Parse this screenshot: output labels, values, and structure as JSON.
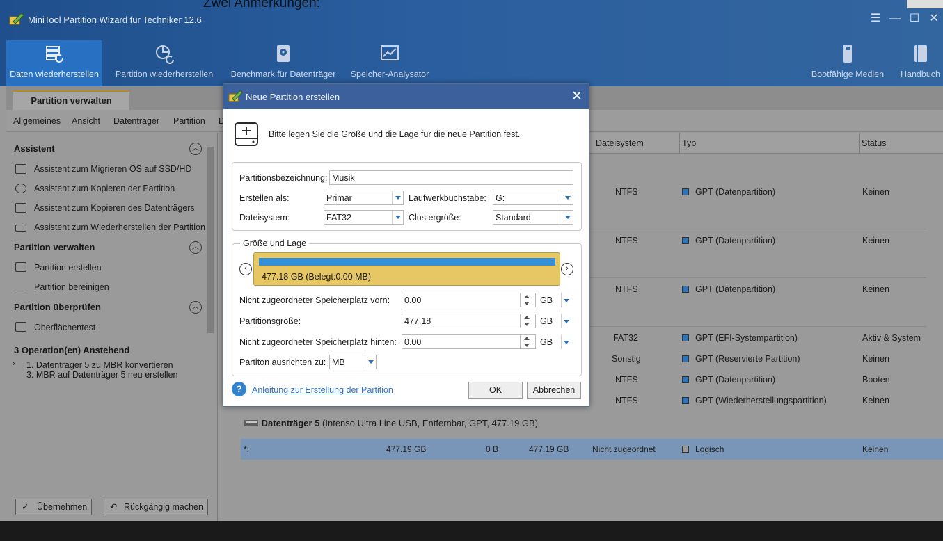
{
  "background_text": "Zwei Anmerkungen:",
  "app": {
    "title": "MiniTool Partition Wizard für Techniker 12.6"
  },
  "window_icons": {
    "menu": "hamburger-icon",
    "minimize": "minimize-icon",
    "maximize": "maximize-icon",
    "close": "close-icon"
  },
  "toolbar": {
    "items": [
      {
        "label": "Daten wiederherstellen",
        "icon": "data-recovery-icon",
        "active": true
      },
      {
        "label": "Partition wiederherstellen",
        "icon": "partition-recovery-icon"
      },
      {
        "label": "Benchmark für Datenträger",
        "icon": "disk-benchmark-icon"
      },
      {
        "label": "Speicher-Analysator",
        "icon": "space-analyzer-icon"
      },
      {
        "label": "Bootfähige Medien",
        "icon": "bootable-media-icon"
      },
      {
        "label": "Handbuch",
        "icon": "manual-icon"
      }
    ]
  },
  "tab": {
    "label": "Partition verwalten"
  },
  "menu": {
    "items": [
      "Allgemeines",
      "Ansicht",
      "Datenträger",
      "Partition",
      "D"
    ]
  },
  "left": {
    "sections": [
      {
        "title": "Assistent",
        "items": [
          "Assistent zum Migrieren OS auf SSD/HD",
          "Assistent zum Kopieren der Partition",
          "Assistent zum Kopieren des Datenträgers",
          "Assistent zum Wiederherstellen der Partition"
        ]
      },
      {
        "title": "Partition verwalten",
        "items": [
          "Partition erstellen",
          "Partition bereinigen"
        ]
      },
      {
        "title": "Partition überprüfen",
        "items": [
          "Oberflächentest"
        ]
      }
    ],
    "pending": {
      "title": "3 Operation(en) Anstehend",
      "items": [
        "1. Datenträger 5 zu MBR konvertieren",
        "3. MBR auf Datenträger 5 neu erstellen"
      ]
    },
    "apply_label": "Übernehmen",
    "undo_label": "Rückgängig machen"
  },
  "table": {
    "headers": {
      "filesystem": "Dateisystem",
      "type": "Typ",
      "status": "Status"
    },
    "rows": [
      {
        "fs": "NTFS",
        "type": "GPT (Datenpartition)",
        "status": "Keinen"
      },
      {
        "fs": "NTFS",
        "type": "GPT (Datenpartition)",
        "status": "Keinen"
      },
      {
        "fs": "NTFS",
        "type": "GPT (Datenpartition)",
        "status": "Keinen"
      },
      {
        "fs": "FAT32",
        "type": "GPT (EFI-Systempartition)",
        "status": "Aktiv & System"
      },
      {
        "fs": "Sonstig",
        "type": "GPT (Reservierte Partition)",
        "status": "Keinen"
      },
      {
        "fs": "NTFS",
        "type": "GPT (Datenpartition)",
        "status": "Booten"
      },
      {
        "fs": "NTFS",
        "type": "GPT (Wiederherstellungspartition)",
        "status": "Keinen"
      }
    ],
    "disk5": {
      "name": "Datenträger 5",
      "detail": " (Intenso Ultra Line USB, Entfernbar, GPT, 477.19 GB)"
    },
    "disk5_row": {
      "name": "*:",
      "capacity": "477.19 GB",
      "used": "0 B",
      "unused": "477.19 GB",
      "fs": "Nicht zugeordnet",
      "type": "Logisch",
      "status": "Keinen"
    }
  },
  "dialog": {
    "title": "Neue Partition erstellen",
    "intro": "Bitte legen Sie die Größe und die Lage für die neue Partition fest.",
    "fields": {
      "label_lbl": "Partitionsbezeichnung:",
      "label_val": "Musik",
      "create_as_lbl": "Erstellen als:",
      "create_as_val": "Primär",
      "drive_letter_lbl": "Laufwerkbuchstabe:",
      "drive_letter_val": "G:",
      "filesystem_lbl": "Dateisystem:",
      "filesystem_val": "FAT32",
      "cluster_lbl": "Clustergröße:",
      "cluster_val": "Standard"
    },
    "size_group": {
      "title": "Größe und Lage",
      "bar_label": "477.18 GB (Belegt:0.00 MB)",
      "unalloc_before_lbl": "Nicht zugeordneter Speicherplatz vorn:",
      "unalloc_before_val": "0.00",
      "size_lbl": "Partitionsgröße:",
      "size_val": "477.18",
      "unalloc_after_lbl": "Nicht zugeordneter Speicherplatz hinten:",
      "unalloc_after_val": "0.00",
      "unit": "GB",
      "align_lbl": "Partiton ausrichten zu:",
      "align_val": "MB"
    },
    "help_link": "Anleitung zur Erstellung der Partition",
    "ok": "OK",
    "cancel": "Abbrechen"
  }
}
